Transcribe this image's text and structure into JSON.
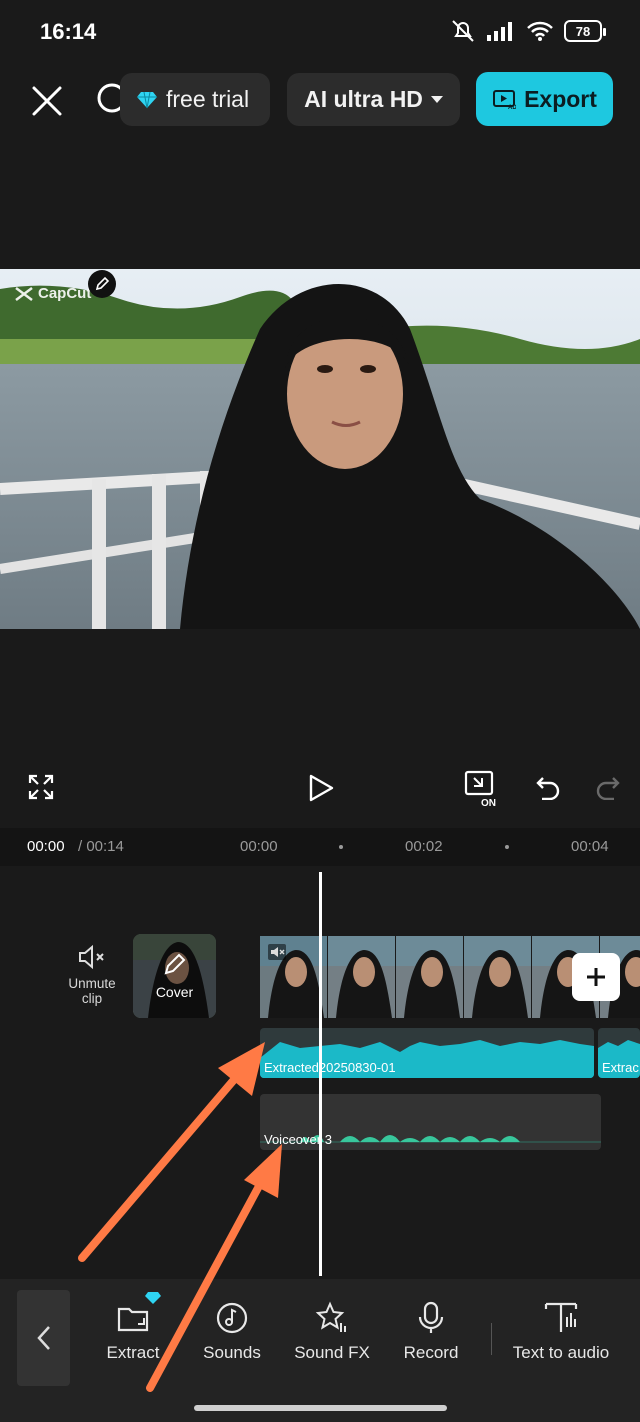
{
  "status": {
    "time": "16:14",
    "battery": "78"
  },
  "topbar": {
    "trial_label": "free trial",
    "quality_label": "AI ultra HD",
    "export_label": "Export"
  },
  "preview": {
    "watermark": "CapCut"
  },
  "timeline": {
    "current_time": "00:00",
    "total_time": "/ 00:14",
    "ticks": [
      "00:00",
      "00:02",
      "00:04"
    ],
    "unmute_label": "Unmute\nclip",
    "cover_label": "Cover",
    "audio_track_label": "Extracted20250830-01",
    "audio_track_label_2": "Extrac",
    "voiceover_label": "Voiceover 3"
  },
  "bottombar": {
    "tools": [
      "Extract",
      "Sounds",
      "Sound FX",
      "Record",
      "Text to audio"
    ]
  },
  "colors": {
    "accent": "#1ec8e0",
    "audio_wave": "#1bb9c8",
    "voice_wave": "#38c79c",
    "annotation_arrow": "#ff7a45"
  }
}
